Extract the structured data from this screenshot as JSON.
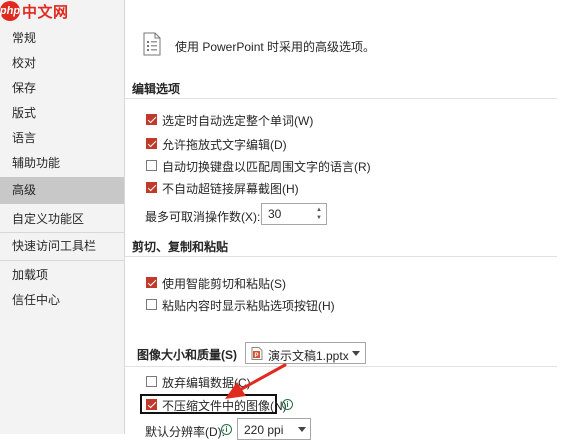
{
  "logo": {
    "badge": "php",
    "text": "中文网"
  },
  "sidebar": {
    "items": [
      {
        "label": "常规"
      },
      {
        "label": "校对"
      },
      {
        "label": "保存"
      },
      {
        "label": "版式"
      },
      {
        "label": "语言"
      },
      {
        "label": "辅助功能"
      },
      {
        "label": "高级",
        "selected": true
      },
      {
        "label": "自定义功能区"
      },
      {
        "label": "快速访问工具栏"
      },
      {
        "label": "加载项"
      },
      {
        "label": "信任中心"
      }
    ]
  },
  "header": {
    "text": "使用 PowerPoint 时采用的高级选项。",
    "icon": "document-settings-icon"
  },
  "editing": {
    "title": "编辑选项",
    "options": [
      {
        "label": "选定时自动选定整个单词(W)",
        "checked": true
      },
      {
        "label": "允许拖放式文字编辑(D)",
        "checked": true
      },
      {
        "label": "自动切换键盘以匹配周围文字的语言(R)",
        "checked": false
      },
      {
        "label": "不自动超链接屏幕截图(H)",
        "checked": true
      }
    ],
    "undo_label": "最多可取消操作数(X):",
    "undo_value": "30"
  },
  "clipboard": {
    "title": "剪切、复制和粘贴",
    "options": [
      {
        "label": "使用智能剪切和粘贴(S)",
        "checked": true
      },
      {
        "label": "粘贴内容时显示粘贴选项按钮(H)",
        "checked": false
      }
    ]
  },
  "image": {
    "title": "图像大小和质量(S)",
    "file_select": "演示文稿1.pptx",
    "options": [
      {
        "label": "放弃编辑数据(C)",
        "checked": false
      },
      {
        "label": "不压缩文件中的图像(N)",
        "checked": true
      }
    ],
    "resolution_label": "默认分辨率(D):",
    "resolution_value": "220 ppi",
    "info_glyph": "i"
  },
  "colors": {
    "accent": "#c0392b",
    "arrow": "#e02a20",
    "selected_nav": "#c8c8c8"
  }
}
